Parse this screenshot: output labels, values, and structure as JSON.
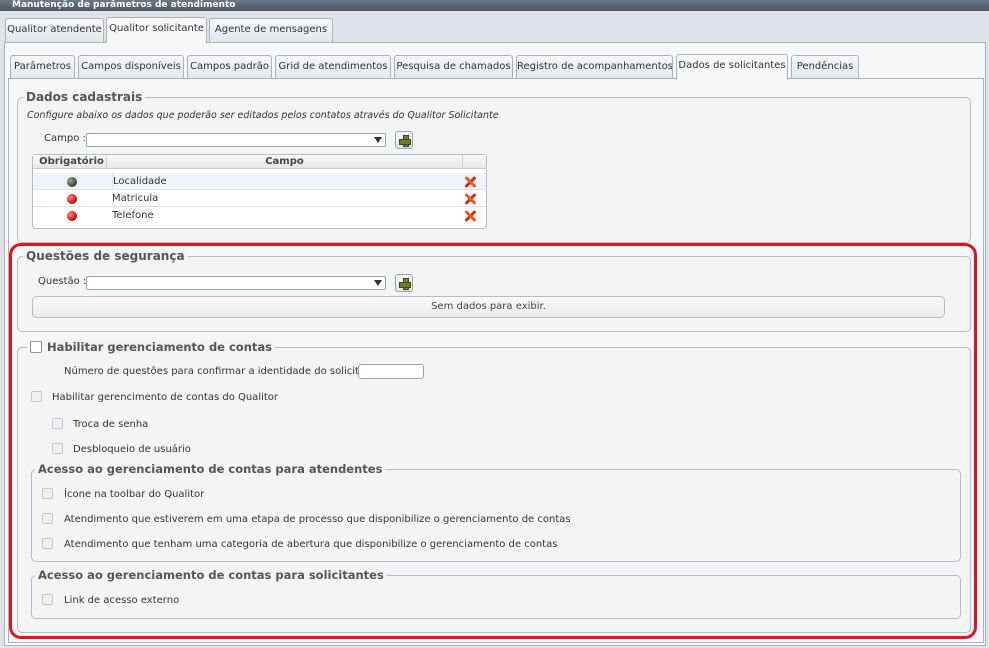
{
  "window": {
    "title": "Manutenção de parâmetros de atendimento"
  },
  "top_tabs": [
    {
      "label": "Qualitor atendente"
    },
    {
      "label": "Qualitor solicitante"
    },
    {
      "label": "Agente de mensagens"
    }
  ],
  "sub_tabs": [
    {
      "label": "Parâmetros"
    },
    {
      "label": "Campos disponíveis"
    },
    {
      "label": "Campos padrão"
    },
    {
      "label": "Grid de atendimentos"
    },
    {
      "label": "Pesquisa de chamados"
    },
    {
      "label": "Registro de acompanhamentos"
    },
    {
      "label": "Dados de solicitantes"
    },
    {
      "label": "Pendências"
    }
  ],
  "dados_cadastrais": {
    "legend": "Dados cadastrais",
    "description": "Configure abaixo os dados que poderão ser editados pelos contatos através do Qualitor Solicitante",
    "campo_label": "Campo :",
    "campo_value": "",
    "grid": {
      "headers": [
        "Obrigatório",
        "Campo"
      ],
      "rows": [
        {
          "status": "green",
          "campo": "Localidade"
        },
        {
          "status": "red",
          "campo": "Matricula"
        },
        {
          "status": "red",
          "campo": "Telefone"
        }
      ]
    }
  },
  "questoes": {
    "legend": "Questões de segurança",
    "questao_label": "Questão :",
    "questao_value": "",
    "empty_text": "Sem dados para exibir."
  },
  "gerenciamento": {
    "legend": "Habilitar gerenciamento de contas",
    "num_questoes_label": "Número de questões para confirmar a identidade do solicitante :",
    "num_questoes_value": "",
    "habilitar_qualitor": "Habilitar gerencimento de contas do Qualitor",
    "troca_senha": "Troca de senha",
    "desbloqueio": "Desbloqueio de usuário",
    "acesso_atendentes": {
      "legend": "Acesso ao gerenciamento de contas para atendentes",
      "options": [
        "Ícone na toolbar do Qualitor",
        "Atendimento que estiverem em uma etapa de processo que disponibilize o gerenciamento de contas",
        "Atendimento que tenham uma categoria de abertura que disponibilize o gerenciamento de contas"
      ]
    },
    "acesso_solicitantes": {
      "legend": "Acesso ao gerenciamento de contas para solicitantes",
      "options": [
        "Link de acesso externo"
      ]
    }
  },
  "colors": {
    "highlight": "#e0141e",
    "title_bar": "#4b5663"
  }
}
